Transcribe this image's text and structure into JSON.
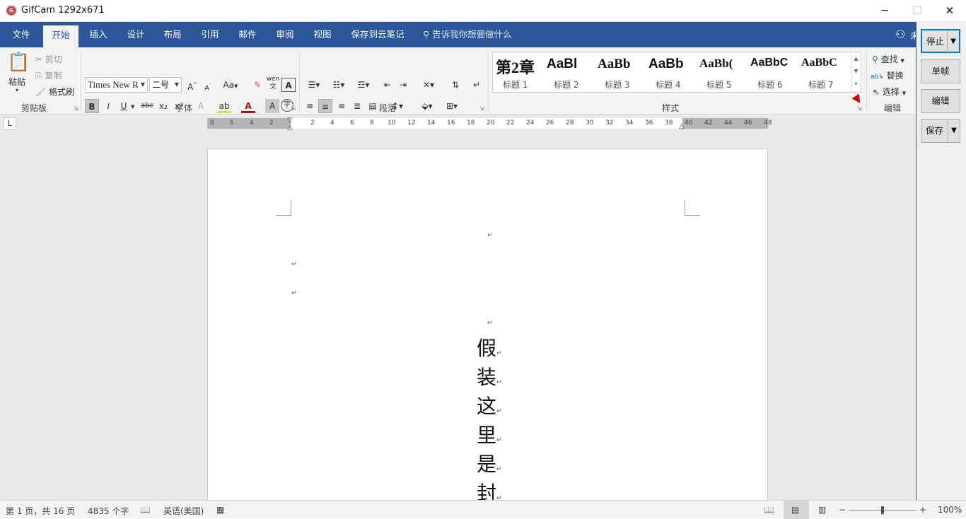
{
  "gifcam": {
    "title": "GifCam 1292x671",
    "app_icon": "gifcam-icon",
    "window_buttons": [
      "─",
      "☐",
      "✕"
    ],
    "buttons": [
      {
        "label": "停止",
        "dropdown": true
      },
      {
        "label": "单帧",
        "dropdown": false
      },
      {
        "label": "编辑",
        "dropdown": false
      },
      {
        "label": "保存",
        "dropdown": true
      }
    ]
  },
  "word": {
    "tabs": [
      "文件",
      "开始",
      "插入",
      "设计",
      "布局",
      "引用",
      "邮件",
      "审阅",
      "视图",
      "保存到云笔记"
    ],
    "active_tab": "开始",
    "tell_me": "告诉我你想要做什么",
    "user_truncated": "未",
    "clipboard": {
      "paste": "粘贴",
      "cut": "剪切",
      "copy": "复制",
      "format_painter": "格式刷",
      "group": "剪贴板"
    },
    "font": {
      "name": "Times New R",
      "size": "二号",
      "grow": "A",
      "shrink": "A",
      "change_case": "Aa",
      "phonetic": "wén",
      "bold": "B",
      "italic": "I",
      "underline": "U",
      "strike": "abc",
      "subscript": "x₂",
      "superscript": "x²",
      "group": "字体"
    },
    "paragraph": {
      "group": "段落"
    },
    "styles": {
      "items": [
        {
          "sample": "第2章",
          "name": "标题 1"
        },
        {
          "sample": "AaBl",
          "name": "标题 2"
        },
        {
          "sample": "AaBb",
          "name": "标题 3"
        },
        {
          "sample": "AaBb",
          "name": "标题 4"
        },
        {
          "sample": "AaBb(",
          "name": "标题 5"
        },
        {
          "sample": "AaBbC",
          "name": "标题 6"
        },
        {
          "sample": "AaBbC",
          "name": "标题 7"
        }
      ],
      "group": "样式"
    },
    "editing": {
      "find": "查找",
      "replace": "替换",
      "select": "选择",
      "group": "编辑"
    },
    "ruler_ticks_left": [
      "8",
      "6",
      "4",
      "2"
    ],
    "ruler_ticks": [
      "2",
      "4",
      "6",
      "8",
      "10",
      "12",
      "14",
      "16",
      "18",
      "20",
      "22",
      "24",
      "26",
      "28",
      "30",
      "32",
      "34",
      "36",
      "38",
      "40",
      "42",
      "44",
      "46",
      "48"
    ],
    "tab_selector": "L",
    "paragraph_mark": "↵",
    "document_text": [
      "假",
      "装",
      "这",
      "里",
      "是",
      "封"
    ],
    "status": {
      "page": "第 1 页，共 16 页",
      "words": "4835 个字",
      "language": "英语(美国)",
      "zoom_minus": "−",
      "zoom_plus": "+",
      "zoom": "100%"
    }
  }
}
